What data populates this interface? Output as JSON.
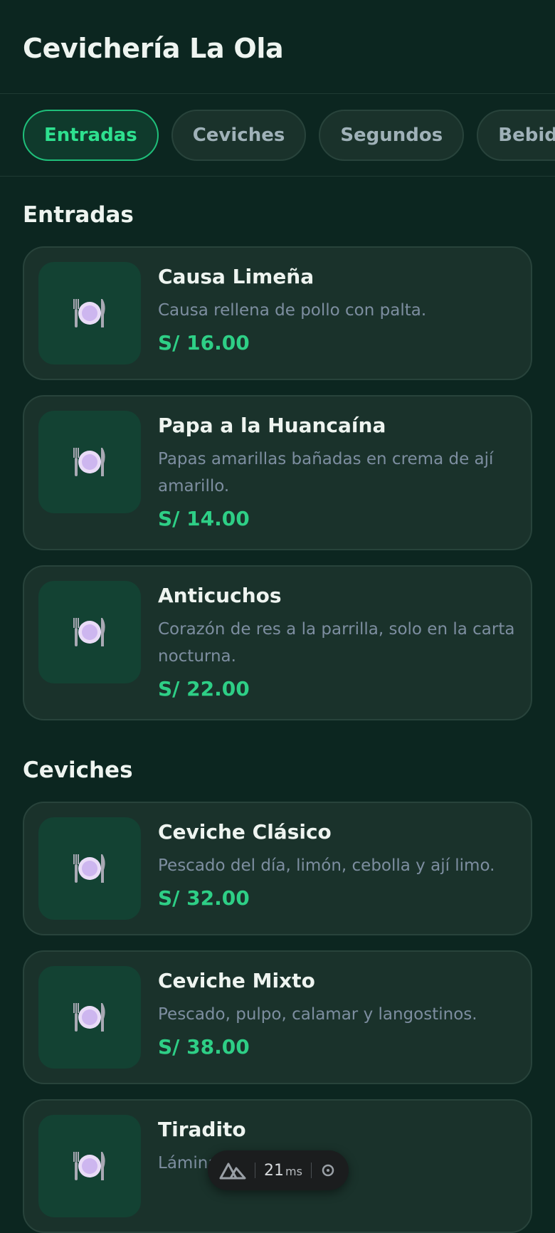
{
  "header": {
    "title": "Cevichería La Ola"
  },
  "tabs": [
    {
      "label": "Entradas",
      "active": true
    },
    {
      "label": "Ceviches",
      "active": false
    },
    {
      "label": "Segundos",
      "active": false
    },
    {
      "label": "Bebidas",
      "active": false
    }
  ],
  "sections": [
    {
      "title": "Entradas",
      "items": [
        {
          "name": "Causa Limeña",
          "description": "Causa rellena de pollo con palta.",
          "price": "S/ 16.00",
          "icon": "plate-cutlery-icon"
        },
        {
          "name": "Papa a la Huancaína",
          "description": "Papas amarillas bañadas en crema de ají amarillo.",
          "price": "S/ 14.00",
          "icon": "plate-cutlery-icon"
        },
        {
          "name": "Anticuchos",
          "description": "Corazón de res a la parrilla, solo en la carta nocturna.",
          "price": "S/ 22.00",
          "icon": "plate-cutlery-icon"
        }
      ]
    },
    {
      "title": "Ceviches",
      "items": [
        {
          "name": "Ceviche Clásico",
          "description": "Pescado del día, limón, cebolla y ají limo.",
          "price": "S/ 32.00",
          "icon": "plate-cutlery-icon"
        },
        {
          "name": "Ceviche Mixto",
          "description": "Pescado, pulpo, calamar y langostinos.",
          "price": "S/ 38.00",
          "icon": "plate-cutlery-icon"
        },
        {
          "name": "Tiradito",
          "description": "Lámina... salsa de ají",
          "price": "",
          "icon": "plate-cutlery-icon"
        }
      ]
    }
  ],
  "devbar": {
    "value": "21",
    "unit": "ms"
  },
  "colors": {
    "accent": "#2ecf86",
    "background": "#0c2620",
    "card": "#1a322b"
  }
}
